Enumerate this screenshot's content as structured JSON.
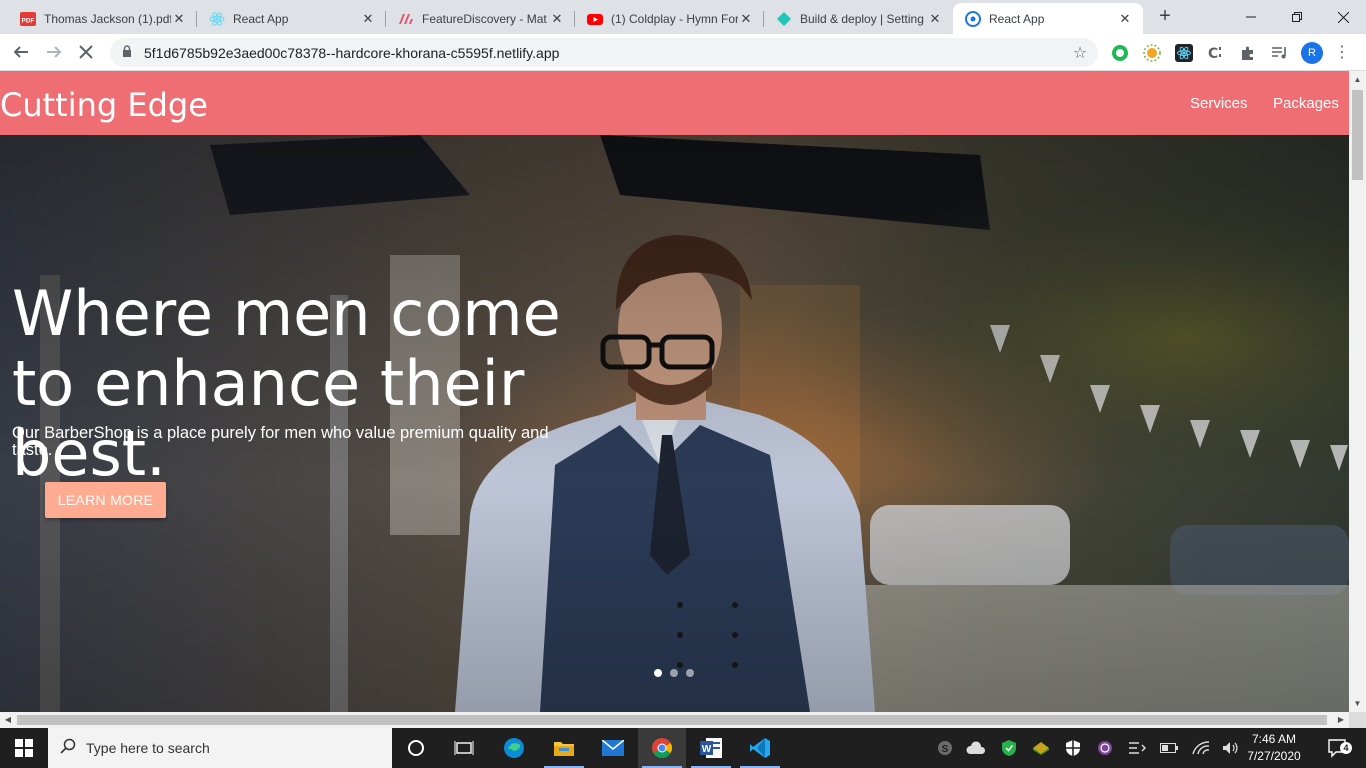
{
  "browser": {
    "tabs": [
      {
        "label": "Thomas Jackson (1).pdf",
        "icon": "pdf-icon"
      },
      {
        "label": "React App",
        "icon": "react-icon"
      },
      {
        "label": "FeatureDiscovery - Mat",
        "icon": "material-icon"
      },
      {
        "label": "(1) Coldplay - Hymn For",
        "icon": "youtube-icon"
      },
      {
        "label": "Build & deploy | Setting",
        "icon": "netlify-icon"
      },
      {
        "label": "React App",
        "icon": "react-icon"
      }
    ],
    "active_tab_index": 5,
    "url": "5f1d6785b92e3aed00c78378--hardcore-khorana-c5595f.netlify.app",
    "profile_initial": "R"
  },
  "site": {
    "brand": "Cutting Edge",
    "nav": [
      "Services",
      "Packages"
    ],
    "accent_color": "#ee6e73",
    "hero": {
      "title": "Where men come to enhance their best.",
      "subtitle": "Our BarberShop is a place purely for men who value premium quality and taste.",
      "cta": "LEARN MORE",
      "cta_color": "#ffab91",
      "slide_count": 3,
      "active_slide": 0
    }
  },
  "taskbar": {
    "search_placeholder": "Type here to search",
    "time": "7:46 AM",
    "date": "7/27/2020",
    "notification_count": "4"
  }
}
